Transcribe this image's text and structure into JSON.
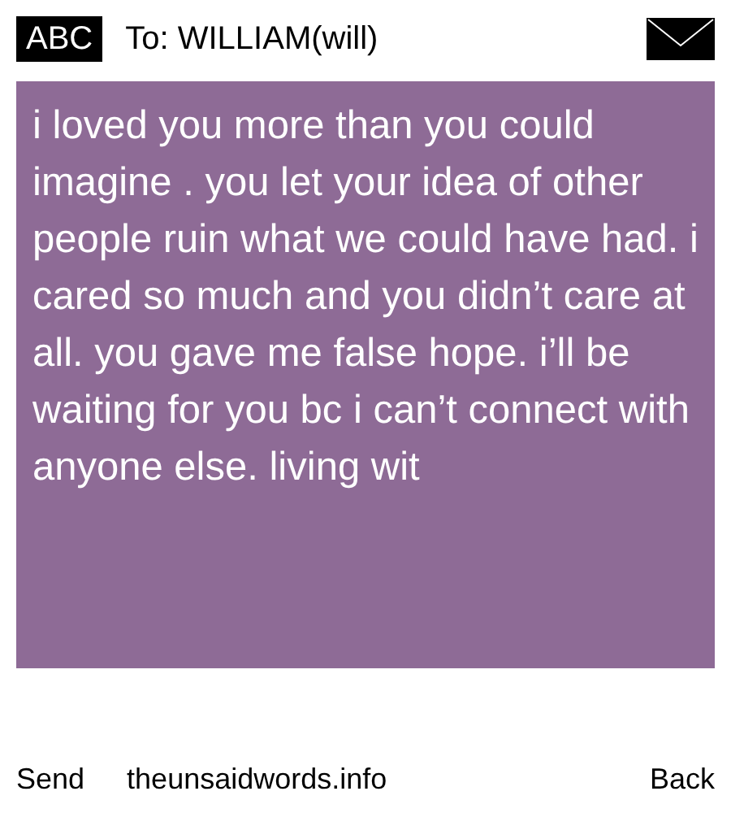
{
  "header": {
    "keyboard_mode": "ABC",
    "recipient": "To: WILLIAM(will)"
  },
  "message": "i loved you more than you could imagine . you let your idea of other people ruin what we could have had. i cared so much and you didn’t care at all. you gave me false hope. i’ll be waiting for you bc i can’t connect with anyone else. living wit",
  "footer": {
    "send": "Send",
    "site": "theunsaidwords.info",
    "back": "Back"
  }
}
